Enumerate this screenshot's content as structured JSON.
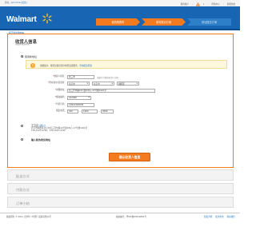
{
  "utility": {
    "greeting": "您好，",
    "username": "John Doe",
    "logout": "[退出]",
    "links": [
      "我的账户",
      "帮助中心",
      "客服热线"
    ],
    "cart_count": "1"
  },
  "header": {
    "logo": "Walmart",
    "steps": [
      "我的购物车",
      "填写核对订单",
      "成功提交订单"
    ]
  },
  "back_link": "返回我的购物车",
  "address": {
    "title": "收货人信息",
    "subtitle": "请选择收货地址",
    "option_new": "使用新地址",
    "alert_text": "重要提示：我们仅提供部分地区送货服务，",
    "alert_link": "查询配送范围",
    "form": {
      "name_label": "收货人姓名：",
      "name_value": "张三丰",
      "name_hint": "请填写完整的收货人姓名",
      "region_label": "所在省市/直辖市：",
      "province": "北京市",
      "city": "北京市",
      "district": "朝阳区",
      "detail_label": "详细地址：",
      "detail_value": "北三环中路10号建X中心 27号楼1201室",
      "zip_label": "邮政编码：",
      "zip_value": "101600",
      "mobile_label": "手机号码：",
      "mobile_value": "13912345678",
      "phone_label": "固定电话：",
      "phone_area": "010",
      "phone_number": "1900",
      "phone_ext": "0596"
    },
    "option2_name": "王五四",
    "option2_tag": "(默认)",
    "option2_line1": "北京市朝阳区北京市北三环中路10号建X中心 27号楼1201室",
    "option2_line2": "139-1525-4792，139-1525-4792",
    "option3_label": "输入新的收货地址",
    "confirm_button": "确认收货人信息"
  },
  "sections": [
    "配送方式",
    "付款方式",
    "订单小结"
  ],
  "footer": {
    "copyright": "版权所有 © 2011 沃尔玛（中国）投资有限公司",
    "icp": "备案编号：粤ICP备05014891号",
    "links": [
      "隐私声明",
      "使用条款",
      "联系我们"
    ]
  },
  "colors": {
    "brand_blue": "#1866b3",
    "accent_orange": "#f47a20"
  }
}
